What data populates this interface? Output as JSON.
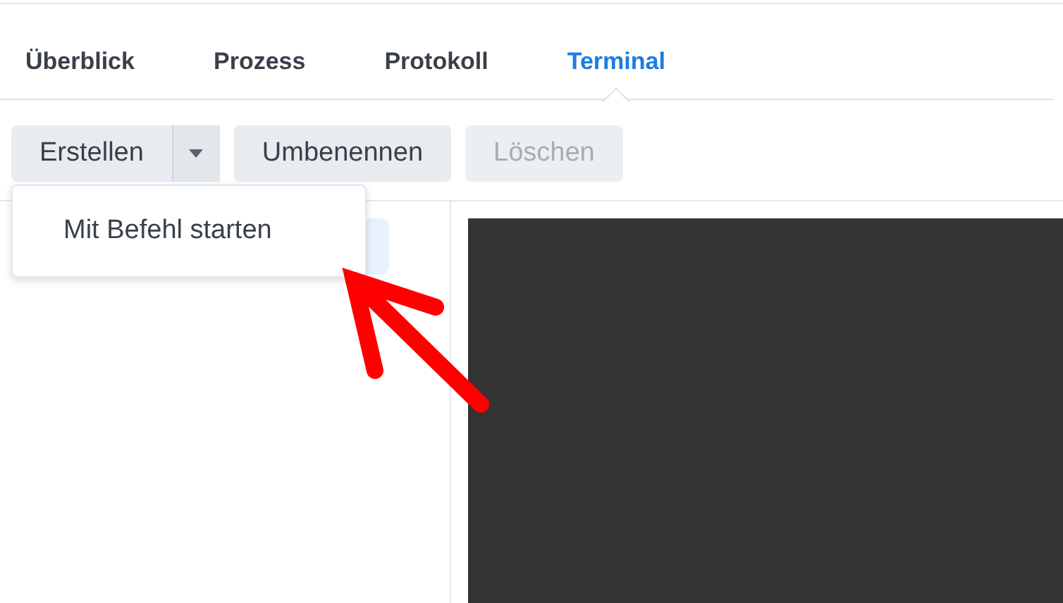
{
  "tabs": [
    {
      "label": "Überblick",
      "selected": false
    },
    {
      "label": "Prozess",
      "selected": false
    },
    {
      "label": "Protokoll",
      "selected": false
    },
    {
      "label": "Terminal",
      "selected": true
    }
  ],
  "toolbar": {
    "split_button": {
      "label": "Erstellen",
      "expanded": true
    },
    "buttons": [
      {
        "label": "Umbenennen",
        "disabled": false
      },
      {
        "label": "Löschen",
        "disabled": true
      }
    ]
  },
  "dropdown_menu": {
    "items": [
      {
        "label": "Mit Befehl starten"
      }
    ]
  }
}
